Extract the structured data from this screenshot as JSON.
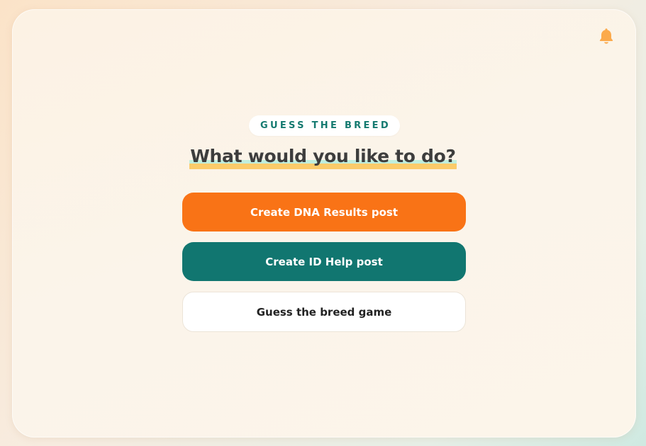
{
  "header": {
    "notification_icon": "bell-icon",
    "accent_color": "#fbaa4c"
  },
  "main": {
    "badge": "GUESS THE BREED",
    "title": "What would you like to do?",
    "buttons": {
      "dna": "Create DNA Results post",
      "id_help": "Create ID Help post",
      "game": "Guess the breed game"
    }
  },
  "colors": {
    "primary_orange": "#f97316",
    "primary_teal": "#117670",
    "badge_text": "#157a70",
    "title_text": "#3d3d3d",
    "highlight_yellow": "#fbcb6a",
    "highlight_mint": "#bfeedd"
  }
}
